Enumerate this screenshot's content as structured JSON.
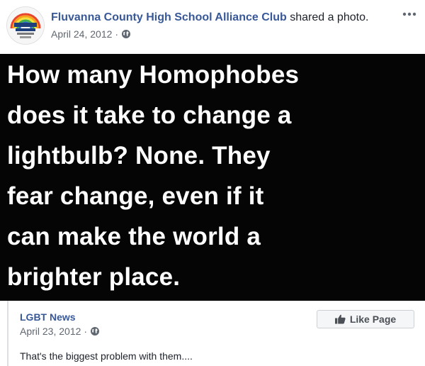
{
  "post": {
    "author": "Fluvanna County High School Alliance Club",
    "action": "shared a photo.",
    "date": "April 24, 2012",
    "separator": "·",
    "privacy_icon": "globe-icon",
    "more_icon": "more-options-icon"
  },
  "photo": {
    "lines": [
      "How many Homophobes",
      "does it take to change a",
      "lightbulb? None. They",
      "fear change, even if it",
      "can make the world a",
      "brighter place."
    ],
    "background": "#050505",
    "text_color": "#ffffff"
  },
  "shared": {
    "source": "LGBT News",
    "date": "April 23, 2012",
    "separator": "·",
    "like_button_label": "Like Page",
    "like_icon": "thumbs-up-icon",
    "caption": "That's the biggest problem with them...."
  },
  "colors": {
    "link": "#385898",
    "meta": "#606770",
    "border": "#dddfe2"
  }
}
